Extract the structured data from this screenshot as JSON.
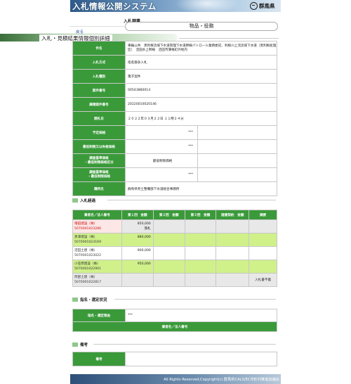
{
  "header": {
    "system_title": "入札情報公開システム",
    "pref_name": "群馬県"
  },
  "subheader": {
    "label": "入札調書",
    "category": "物品・役務",
    "back_link": "戻る",
    "page_title": "入札・見積結果情報個別詳細"
  },
  "details": [
    {
      "label": "件名",
      "value": "車輪公共　黒利根流域下水道管理下水道幹線パトロール業務委託、利根川上流流域下水道（黒利根処理区）　沼田水上幹線　沼田市薄根町外地内"
    },
    {
      "label": "入札方式",
      "value": "指名競争入札"
    },
    {
      "label": "入札種別",
      "value": "電子案件"
    },
    {
      "label": "案件番号",
      "value": "00543880014"
    },
    {
      "label": "調達案件番号",
      "value": "20220010020146"
    },
    {
      "label": "開札日",
      "value": "２０２２年０３月２２日 １１時２４分"
    },
    {
      "label": "予定価格",
      "value": "***"
    },
    {
      "label": "最低制限又は失格価格",
      "value": "***"
    },
    {
      "label": "調査基準価格\n・最低制限価格区分",
      "value": "最低制限価格"
    },
    {
      "label": "調査基準価格\n・最低制限価格",
      "value": "***"
    },
    {
      "label": "購所名",
      "value": "群馬県県土整備部下水道総合事務所"
    }
  ],
  "bid_section": {
    "heading": "入札経過",
    "columns": [
      "業者名／法人番号",
      "第１回　金額",
      "第２回　金額",
      "第３回　金額",
      "随意契約　金額",
      "摘要"
    ],
    "rows": [
      {
        "company": "増田建設（株）",
        "corp_no": "5070001023286",
        "r1": "850,000",
        "r1b": "落札",
        "r2": "",
        "r3": "",
        "zui": "",
        "note": ""
      },
      {
        "company": "黒澤建設（株）",
        "corp_no": "5070001023169",
        "r1": "880,000",
        "r1b": "",
        "r2": "",
        "r3": "",
        "zui": "",
        "note": ""
      },
      {
        "company": "沼田土建（株）",
        "corp_no": "5070001023022",
        "r1": "900,000",
        "r1b": "",
        "r2": "",
        "r3": "",
        "zui": "",
        "note": ""
      },
      {
        "company": "小笠原建設（株）",
        "corp_no": "5070001022901",
        "r1": "950,000",
        "r1b": "",
        "r2": "",
        "r3": "",
        "zui": "",
        "note": ""
      },
      {
        "company": "阿部土建（株）",
        "corp_no": "5070001022817",
        "r1": "",
        "r1b": "",
        "r2": "",
        "r3": "",
        "zui": "",
        "note": "入札書不着"
      }
    ]
  },
  "nomination_section": {
    "heading": "指名・選定状況",
    "reason_label": "指名・選定理由",
    "reason_value": "***",
    "list_label": "業者名／法人番号"
  },
  "remarks_section": {
    "heading": "備考",
    "label": "備考",
    "value": ""
  },
  "footer": {
    "copyright": "All Rights Reserved,Copyright(c) 群馬県CALS/EC市町村推進協議会"
  }
}
